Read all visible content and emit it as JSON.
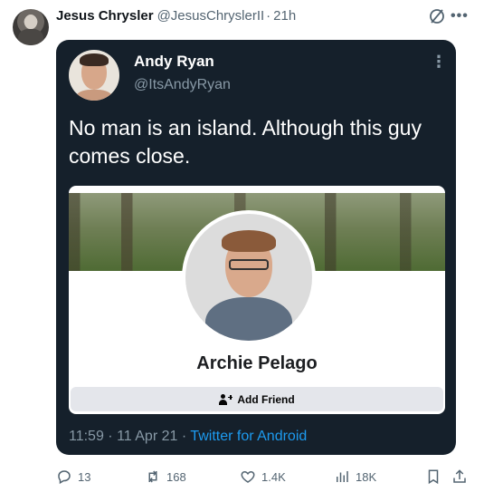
{
  "tweet": {
    "author_name": "Jesus Chrysler",
    "author_handle": "@JesusChryslerII",
    "separator": "·",
    "time": "21h",
    "more_icon": "ellipsis-icon",
    "grok_icon": "grok-icon"
  },
  "screenshot": {
    "author_name": "Andy Ryan",
    "author_handle": "@ItsAndyRyan",
    "text": "No man is an island. Although this guy comes close.",
    "card": {
      "profile_name": "Archie Pelago",
      "button_label": "Add Friend"
    },
    "timestamp": "11:59 · 11 Apr 21",
    "meta_separator": " · ",
    "source": "Twitter for Android",
    "colors": {
      "background": "#15202b",
      "link": "#1d9bf0"
    }
  },
  "actions": {
    "replies": "13",
    "retweets": "168",
    "likes": "1.4K",
    "views": "18K"
  },
  "colors": {
    "text": "#0f1419",
    "secondary": "#536471"
  }
}
